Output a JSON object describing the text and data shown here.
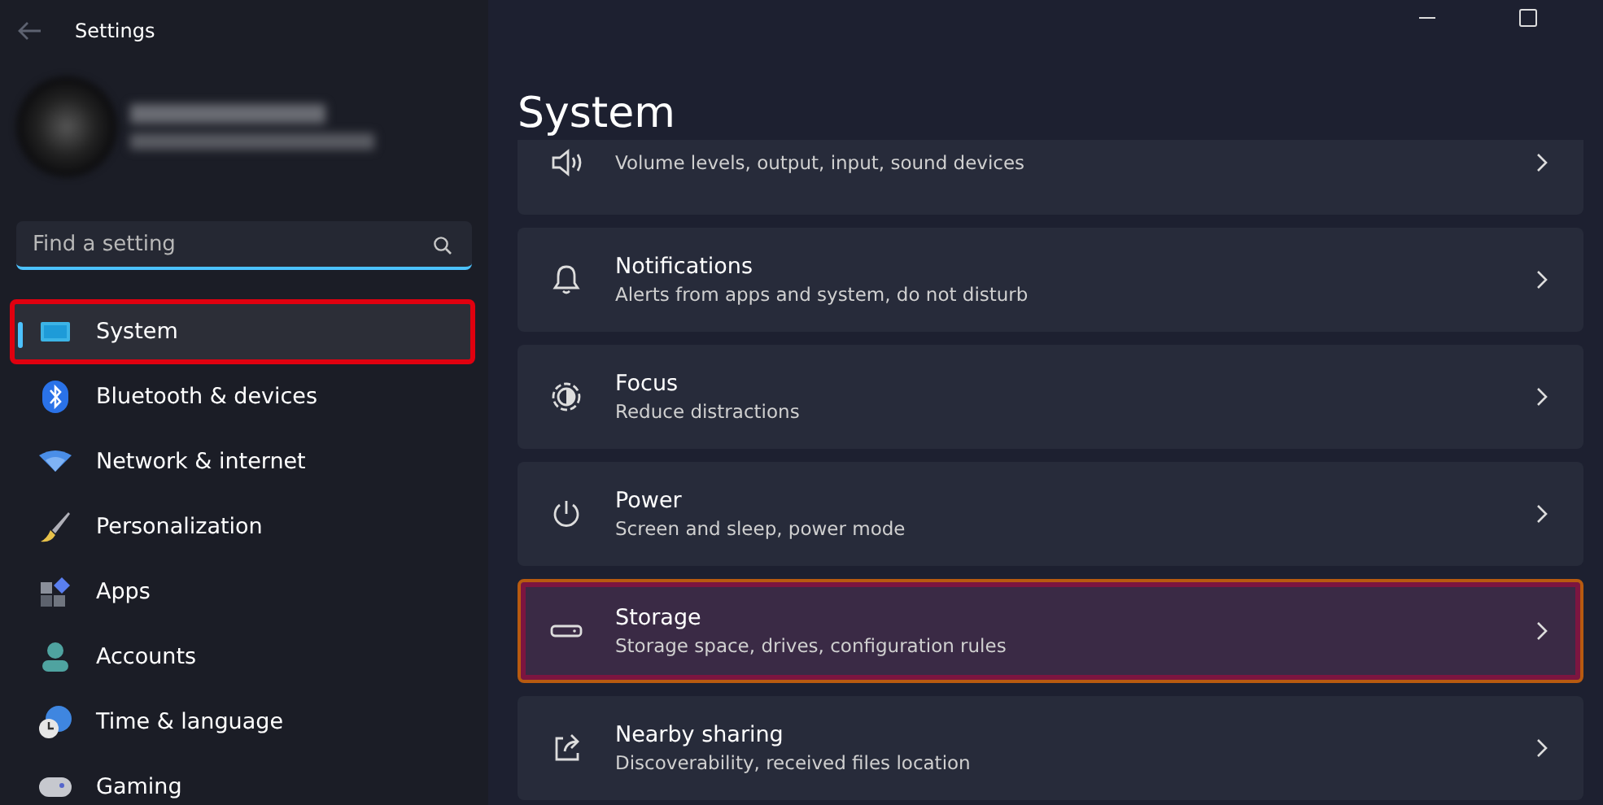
{
  "window": {
    "title": "Settings"
  },
  "search": {
    "placeholder": "Find a setting"
  },
  "nav": [
    {
      "label": "System",
      "selected": true,
      "highlighted": true
    },
    {
      "label": "Bluetooth & devices",
      "selected": false,
      "highlighted": false
    },
    {
      "label": "Network & internet",
      "selected": false,
      "highlighted": false
    },
    {
      "label": "Personalization",
      "selected": false,
      "highlighted": false
    },
    {
      "label": "Apps",
      "selected": false,
      "highlighted": false
    },
    {
      "label": "Accounts",
      "selected": false,
      "highlighted": false
    },
    {
      "label": "Time & language",
      "selected": false,
      "highlighted": false
    },
    {
      "label": "Gaming",
      "selected": false,
      "highlighted": false
    }
  ],
  "page_title": "System",
  "cards": [
    {
      "subtitle": "Volume levels, output, input, sound devices",
      "highlighted": false
    },
    {
      "title": "Notifications",
      "subtitle": "Alerts from apps and system, do not disturb",
      "highlighted": false
    },
    {
      "title": "Focus",
      "subtitle": "Reduce distractions",
      "highlighted": false
    },
    {
      "title": "Power",
      "subtitle": "Screen and sleep, power mode",
      "highlighted": false
    },
    {
      "title": "Storage",
      "subtitle": "Storage space, drives, configuration rules",
      "highlighted": true
    },
    {
      "title": "Nearby sharing",
      "subtitle": "Discoverability, received files location",
      "highlighted": false
    }
  ]
}
